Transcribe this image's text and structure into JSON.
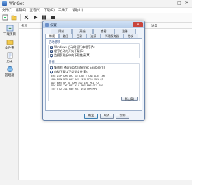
{
  "window": {
    "title": "WinGet",
    "controls": {
      "minimize": "–",
      "maximize": "□",
      "close": "✕"
    }
  },
  "menubar": {
    "items": [
      "文件(F)",
      "编辑(E)",
      "查看(V)",
      "下载(D)",
      "工具(T)",
      "帮助(H)"
    ]
  },
  "toolbar": {
    "icons": [
      "new-download-icon",
      "open-folder-icon",
      "delete-icon",
      "play-icon",
      "pause-icon",
      "stop-icon"
    ]
  },
  "sidebar": {
    "items": [
      {
        "label": "下载项目",
        "icon": "download-list-icon"
      },
      {
        "label": "文件夹",
        "icon": "folder-icon"
      },
      {
        "label": "历史",
        "icon": "history-icon"
      },
      {
        "label": "管理器",
        "icon": "manager-icon"
      }
    ]
  },
  "list": {
    "columns": [
      "名称",
      "进度"
    ]
  },
  "dialog": {
    "title": "设置",
    "close_label": "✕",
    "tabs_row1": [
      "限制",
      "开始",
      "查看",
      "注册"
    ],
    "tabs_row2": [
      "常规",
      "路径",
      "目录",
      "连接",
      "代理服务器",
      "协议"
    ],
    "active_tab": "常规",
    "groups": {
      "startup": {
        "label": "启动选项",
        "options": [
          {
            "label": "Windows 启动时运行本程序(A)",
            "checked": true
          },
          {
            "label": "程序启动时开始下载(S)",
            "checked": true
          },
          {
            "label": "监视剪贴板中的下载链接(M)",
            "checked": true
          }
        ]
      },
      "monitor": {
        "label": "监视",
        "options": [
          {
            "label": "集成到 Microsoft Internet Explorer(I)",
            "checked": true
          },
          {
            "label": "自动下载以下类型文件(E):",
            "checked": true
          }
        ],
        "extensions": [
          "EXE ZIP RAR ARJ GZ LZH Z CAB ACE TAR",
          "JAR BIN MP3 WAV AVI MPG MPEG MOV QT",
          "ASF WMV RM RA RAM ISO IMG MSI 7Z",
          "DOC PDF TXT PPT XLS PNG BMP GIF JPG",
          "TTF TGZ Z01 R00 R01 ICO CHM MP4"
        ],
        "default_button": "默认(D)"
      }
    },
    "buttons": {
      "ok": "确定",
      "cancel": "取消",
      "help": "帮助"
    }
  }
}
